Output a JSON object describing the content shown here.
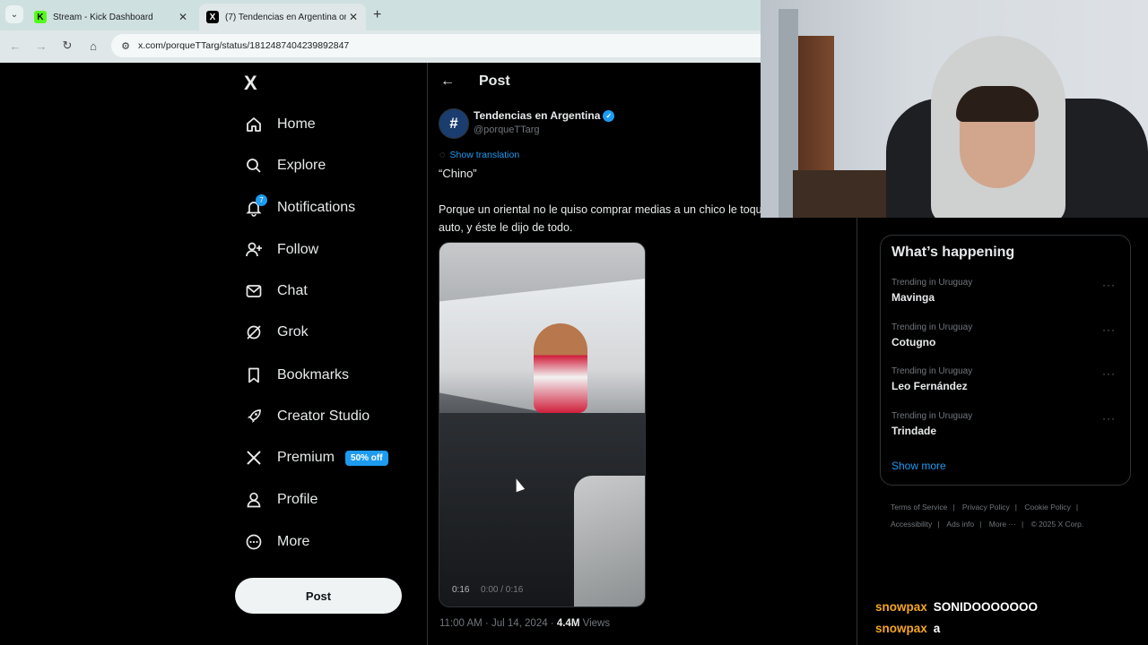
{
  "browser": {
    "tabs": [
      {
        "title": "Stream - Kick Dashboard",
        "favicon": "K"
      },
      {
        "title": "(7) Tendencias en Argentina on",
        "favicon": "X"
      }
    ],
    "url": "x.com/porqueTTarg/status/1812487404239892847"
  },
  "nav": {
    "logo": "X",
    "items": [
      {
        "label": "Home",
        "icon": "home-icon"
      },
      {
        "label": "Explore",
        "icon": "search-icon"
      },
      {
        "label": "Notifications",
        "icon": "bell-icon",
        "badge": "7"
      },
      {
        "label": "Follow",
        "icon": "add-user-icon"
      },
      {
        "label": "Chat",
        "icon": "mail-icon"
      },
      {
        "label": "Grok",
        "icon": "grok-icon"
      },
      {
        "label": "Bookmarks",
        "icon": "bookmark-icon"
      },
      {
        "label": "Creator Studio",
        "icon": "rocket-icon"
      },
      {
        "label": "Premium",
        "icon": "x-icon",
        "promo": "50% off"
      },
      {
        "label": "Profile",
        "icon": "user-icon"
      },
      {
        "label": "More",
        "icon": "more-icon"
      }
    ],
    "post_button": "Post"
  },
  "post": {
    "header_title": "Post",
    "avatar_glyph": "#",
    "author_name": "Tendencias en Argentina",
    "handle": "@porqueTTarg",
    "show_translation": "Show translation",
    "line1": "“Chino”",
    "body": "Porque un oriental no le quiso comprar medias a un chico le toque el auto, y éste le dijo de todo.",
    "video_time": "0:16",
    "video_controls": "0:00 / 0:16",
    "timestamp": "11:00 AM · Jul 14, 2024 · ",
    "views_count": "4.4M",
    "views_label": " Views"
  },
  "trends": {
    "title": "What’s happening",
    "items": [
      {
        "context": "Trending in Uruguay",
        "name": "Mavinga"
      },
      {
        "context": "Trending in Uruguay",
        "name": "Cotugno"
      },
      {
        "context": "Trending in Uruguay",
        "name": "Leo Fernández"
      },
      {
        "context": "Trending in Uruguay",
        "name": "Trindade"
      }
    ],
    "show_more": "Show more"
  },
  "footer": {
    "links": [
      "Terms of Service",
      "Privacy Policy",
      "Cookie Policy",
      "Accessibility",
      "Ads info",
      "More ···"
    ],
    "copyright": "© 2025 X Corp."
  },
  "chat": [
    {
      "user": "snowpax",
      "message": "SONIDOOOOOOO"
    },
    {
      "user": "snowpax",
      "message": "a"
    }
  ],
  "colors": {
    "accent": "#1d9bf0",
    "chat_user": "#f5a623",
    "kick": "#53fc18"
  }
}
